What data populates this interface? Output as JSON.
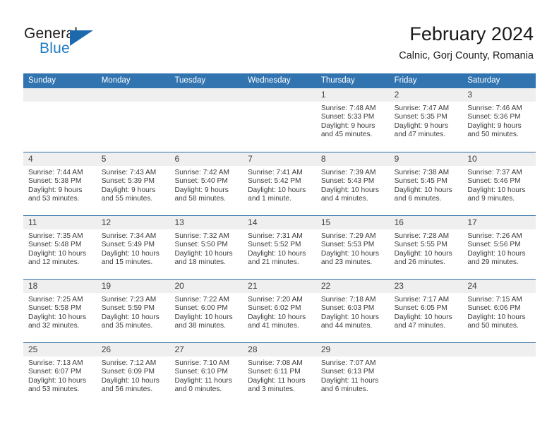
{
  "logo": {
    "word_one": "General",
    "word_two": "Blue",
    "mark": "triangle-flag"
  },
  "header": {
    "title": "February 2024",
    "subtitle": "Calnic, Gorj County, Romania"
  },
  "weekdays": [
    "Sunday",
    "Monday",
    "Tuesday",
    "Wednesday",
    "Thursday",
    "Friday",
    "Saturday"
  ],
  "colors": {
    "header_blue": "#3174b0",
    "row_divider_blue": "#2f6ea6",
    "day_band_gray": "#efefef",
    "logo_blue": "#1f7bc1",
    "text": "#3b3b3b"
  },
  "weeks": [
    [
      {
        "empty": true
      },
      {
        "empty": true
      },
      {
        "empty": true
      },
      {
        "empty": true
      },
      {
        "day": "1",
        "sunrise": "Sunrise: 7:48 AM",
        "sunset": "Sunset: 5:33 PM",
        "daylight_line1": "Daylight: 9 hours",
        "daylight_line2": "and 45 minutes."
      },
      {
        "day": "2",
        "sunrise": "Sunrise: 7:47 AM",
        "sunset": "Sunset: 5:35 PM",
        "daylight_line1": "Daylight: 9 hours",
        "daylight_line2": "and 47 minutes."
      },
      {
        "day": "3",
        "sunrise": "Sunrise: 7:46 AM",
        "sunset": "Sunset: 5:36 PM",
        "daylight_line1": "Daylight: 9 hours",
        "daylight_line2": "and 50 minutes."
      }
    ],
    [
      {
        "day": "4",
        "sunrise": "Sunrise: 7:44 AM",
        "sunset": "Sunset: 5:38 PM",
        "daylight_line1": "Daylight: 9 hours",
        "daylight_line2": "and 53 minutes."
      },
      {
        "day": "5",
        "sunrise": "Sunrise: 7:43 AM",
        "sunset": "Sunset: 5:39 PM",
        "daylight_line1": "Daylight: 9 hours",
        "daylight_line2": "and 55 minutes."
      },
      {
        "day": "6",
        "sunrise": "Sunrise: 7:42 AM",
        "sunset": "Sunset: 5:40 PM",
        "daylight_line1": "Daylight: 9 hours",
        "daylight_line2": "and 58 minutes."
      },
      {
        "day": "7",
        "sunrise": "Sunrise: 7:41 AM",
        "sunset": "Sunset: 5:42 PM",
        "daylight_line1": "Daylight: 10 hours",
        "daylight_line2": "and 1 minute."
      },
      {
        "day": "8",
        "sunrise": "Sunrise: 7:39 AM",
        "sunset": "Sunset: 5:43 PM",
        "daylight_line1": "Daylight: 10 hours",
        "daylight_line2": "and 4 minutes."
      },
      {
        "day": "9",
        "sunrise": "Sunrise: 7:38 AM",
        "sunset": "Sunset: 5:45 PM",
        "daylight_line1": "Daylight: 10 hours",
        "daylight_line2": "and 6 minutes."
      },
      {
        "day": "10",
        "sunrise": "Sunrise: 7:37 AM",
        "sunset": "Sunset: 5:46 PM",
        "daylight_line1": "Daylight: 10 hours",
        "daylight_line2": "and 9 minutes."
      }
    ],
    [
      {
        "day": "11",
        "sunrise": "Sunrise: 7:35 AM",
        "sunset": "Sunset: 5:48 PM",
        "daylight_line1": "Daylight: 10 hours",
        "daylight_line2": "and 12 minutes."
      },
      {
        "day": "12",
        "sunrise": "Sunrise: 7:34 AM",
        "sunset": "Sunset: 5:49 PM",
        "daylight_line1": "Daylight: 10 hours",
        "daylight_line2": "and 15 minutes."
      },
      {
        "day": "13",
        "sunrise": "Sunrise: 7:32 AM",
        "sunset": "Sunset: 5:50 PM",
        "daylight_line1": "Daylight: 10 hours",
        "daylight_line2": "and 18 minutes."
      },
      {
        "day": "14",
        "sunrise": "Sunrise: 7:31 AM",
        "sunset": "Sunset: 5:52 PM",
        "daylight_line1": "Daylight: 10 hours",
        "daylight_line2": "and 21 minutes."
      },
      {
        "day": "15",
        "sunrise": "Sunrise: 7:29 AM",
        "sunset": "Sunset: 5:53 PM",
        "daylight_line1": "Daylight: 10 hours",
        "daylight_line2": "and 23 minutes."
      },
      {
        "day": "16",
        "sunrise": "Sunrise: 7:28 AM",
        "sunset": "Sunset: 5:55 PM",
        "daylight_line1": "Daylight: 10 hours",
        "daylight_line2": "and 26 minutes."
      },
      {
        "day": "17",
        "sunrise": "Sunrise: 7:26 AM",
        "sunset": "Sunset: 5:56 PM",
        "daylight_line1": "Daylight: 10 hours",
        "daylight_line2": "and 29 minutes."
      }
    ],
    [
      {
        "day": "18",
        "sunrise": "Sunrise: 7:25 AM",
        "sunset": "Sunset: 5:58 PM",
        "daylight_line1": "Daylight: 10 hours",
        "daylight_line2": "and 32 minutes."
      },
      {
        "day": "19",
        "sunrise": "Sunrise: 7:23 AM",
        "sunset": "Sunset: 5:59 PM",
        "daylight_line1": "Daylight: 10 hours",
        "daylight_line2": "and 35 minutes."
      },
      {
        "day": "20",
        "sunrise": "Sunrise: 7:22 AM",
        "sunset": "Sunset: 6:00 PM",
        "daylight_line1": "Daylight: 10 hours",
        "daylight_line2": "and 38 minutes."
      },
      {
        "day": "21",
        "sunrise": "Sunrise: 7:20 AM",
        "sunset": "Sunset: 6:02 PM",
        "daylight_line1": "Daylight: 10 hours",
        "daylight_line2": "and 41 minutes."
      },
      {
        "day": "22",
        "sunrise": "Sunrise: 7:18 AM",
        "sunset": "Sunset: 6:03 PM",
        "daylight_line1": "Daylight: 10 hours",
        "daylight_line2": "and 44 minutes."
      },
      {
        "day": "23",
        "sunrise": "Sunrise: 7:17 AM",
        "sunset": "Sunset: 6:05 PM",
        "daylight_line1": "Daylight: 10 hours",
        "daylight_line2": "and 47 minutes."
      },
      {
        "day": "24",
        "sunrise": "Sunrise: 7:15 AM",
        "sunset": "Sunset: 6:06 PM",
        "daylight_line1": "Daylight: 10 hours",
        "daylight_line2": "and 50 minutes."
      }
    ],
    [
      {
        "day": "25",
        "sunrise": "Sunrise: 7:13 AM",
        "sunset": "Sunset: 6:07 PM",
        "daylight_line1": "Daylight: 10 hours",
        "daylight_line2": "and 53 minutes."
      },
      {
        "day": "26",
        "sunrise": "Sunrise: 7:12 AM",
        "sunset": "Sunset: 6:09 PM",
        "daylight_line1": "Daylight: 10 hours",
        "daylight_line2": "and 56 minutes."
      },
      {
        "day": "27",
        "sunrise": "Sunrise: 7:10 AM",
        "sunset": "Sunset: 6:10 PM",
        "daylight_line1": "Daylight: 11 hours",
        "daylight_line2": "and 0 minutes."
      },
      {
        "day": "28",
        "sunrise": "Sunrise: 7:08 AM",
        "sunset": "Sunset: 6:11 PM",
        "daylight_line1": "Daylight: 11 hours",
        "daylight_line2": "and 3 minutes."
      },
      {
        "day": "29",
        "sunrise": "Sunrise: 7:07 AM",
        "sunset": "Sunset: 6:13 PM",
        "daylight_line1": "Daylight: 11 hours",
        "daylight_line2": "and 6 minutes."
      },
      {
        "empty": true
      },
      {
        "empty": true
      }
    ]
  ]
}
